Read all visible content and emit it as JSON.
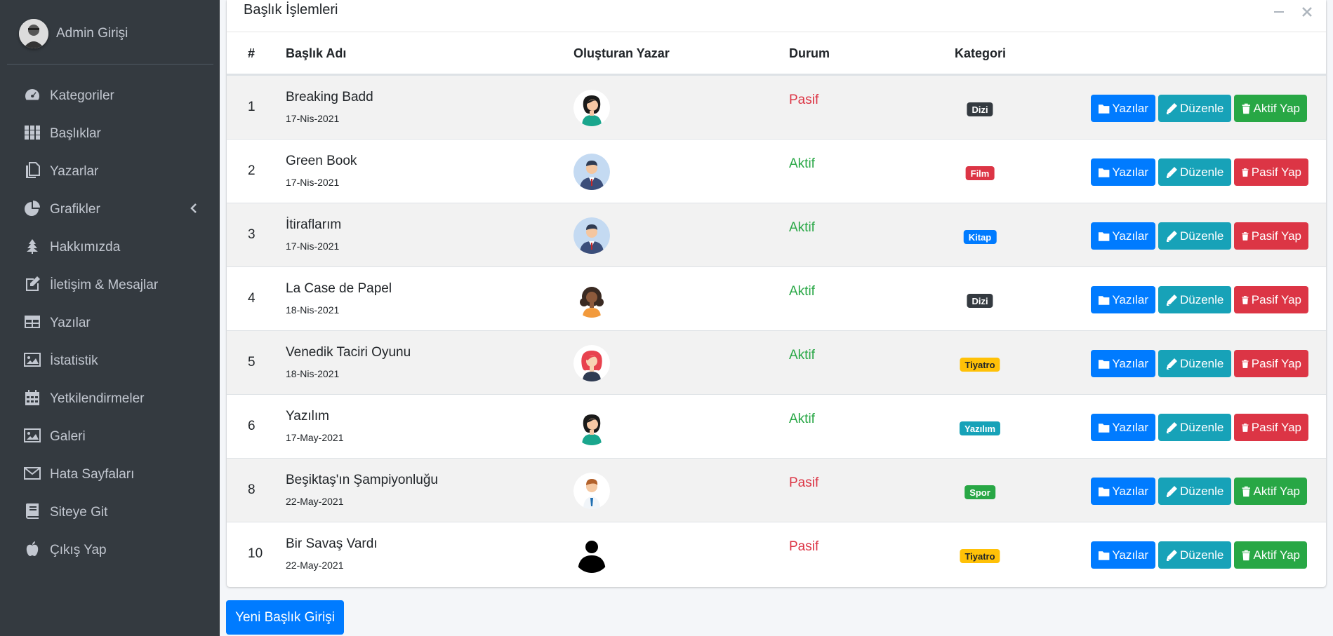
{
  "sidebar": {
    "user_name": "Admin Girişi",
    "items": [
      {
        "label": "Kategoriler",
        "icon": "dashboard-icon"
      },
      {
        "label": "Başlıklar",
        "icon": "grid-icon"
      },
      {
        "label": "Yazarlar",
        "icon": "copy-icon"
      },
      {
        "label": "Grafikler",
        "icon": "pie-chart-icon"
      },
      {
        "label": "Hakkımızda",
        "icon": "tree-icon"
      },
      {
        "label": "İletişim & Mesajlar",
        "icon": "edit-icon"
      },
      {
        "label": "Yazılar",
        "icon": "table-icon"
      },
      {
        "label": "İstatistik",
        "icon": "image-icon"
      },
      {
        "label": "Yetkilendirmeler",
        "icon": "calendar-icon"
      },
      {
        "label": "Galeri",
        "icon": "image-icon"
      },
      {
        "label": "Hata Sayfaları",
        "icon": "envelope-icon"
      },
      {
        "label": "Siteye Git",
        "icon": "book-icon"
      },
      {
        "label": "Çıkış Yap",
        "icon": "apple-icon"
      }
    ]
  },
  "card": {
    "title": "Başlık İşlemleri"
  },
  "table": {
    "headers": {
      "idx": "#",
      "title": "Başlık Adı",
      "author": "Oluşturan Yazar",
      "status": "Durum",
      "category": "Kategori"
    },
    "rows": [
      {
        "idx": "1",
        "title": "Breaking Badd",
        "date": "17-Nis-2021",
        "status": "Pasif",
        "category": "Dizi",
        "cat_color": "#343a40",
        "cat_text": "#ffffff",
        "toggle": "Aktif Yap",
        "avatar": "woman-dark-hair"
      },
      {
        "idx": "2",
        "title": "Green Book",
        "date": "17-Nis-2021",
        "status": "Aktif",
        "category": "Film",
        "cat_color": "#dc3545",
        "cat_text": "#ffffff",
        "toggle": "Pasif Yap",
        "avatar": "man-suit"
      },
      {
        "idx": "3",
        "title": "İtiraflarım",
        "date": "17-Nis-2021",
        "status": "Aktif",
        "category": "Kitap",
        "cat_color": "#007bff",
        "cat_text": "#ffffff",
        "toggle": "Pasif Yap",
        "avatar": "man-suit"
      },
      {
        "idx": "4",
        "title": "La Case de Papel",
        "date": "18-Nis-2021",
        "status": "Aktif",
        "category": "Dizi",
        "cat_color": "#343a40",
        "cat_text": "#ffffff",
        "toggle": "Pasif Yap",
        "avatar": "woman-curly"
      },
      {
        "idx": "5",
        "title": "Venedik Taciri Oyunu",
        "date": "18-Nis-2021",
        "status": "Aktif",
        "category": "Tiyatro",
        "cat_color": "#ffc107",
        "cat_text": "#212529",
        "toggle": "Pasif Yap",
        "avatar": "woman-red-hair"
      },
      {
        "idx": "6",
        "title": "Yazılım",
        "date": "17-May-2021",
        "status": "Aktif",
        "category": "Yazılım",
        "cat_color": "#17a2b8",
        "cat_text": "#ffffff",
        "toggle": "Pasif Yap",
        "avatar": "woman-dark-hair"
      },
      {
        "idx": "8",
        "title": "Beşiktaş'ın Şampiyonluğu",
        "date": "22-May-2021",
        "status": "Pasif",
        "category": "Spor",
        "cat_color": "#28a745",
        "cat_text": "#ffffff",
        "toggle": "Aktif Yap",
        "avatar": "man-shirt"
      },
      {
        "idx": "10",
        "title": "Bir Savaş Vardı",
        "date": "22-May-2021",
        "status": "Pasif",
        "category": "Tiyatro",
        "cat_color": "#ffc107",
        "cat_text": "#212529",
        "toggle": "Aktif Yap",
        "avatar": "silhouette"
      }
    ],
    "buttons": {
      "yazilar": "Yazılar",
      "duzenle": "Düzenle"
    }
  },
  "new_button": "Yeni Başlık Girişi",
  "colors": {
    "sidebar_bg": "#343a40",
    "primary": "#007bff",
    "info": "#17a2b8",
    "success": "#28a745",
    "danger": "#dc3545"
  }
}
